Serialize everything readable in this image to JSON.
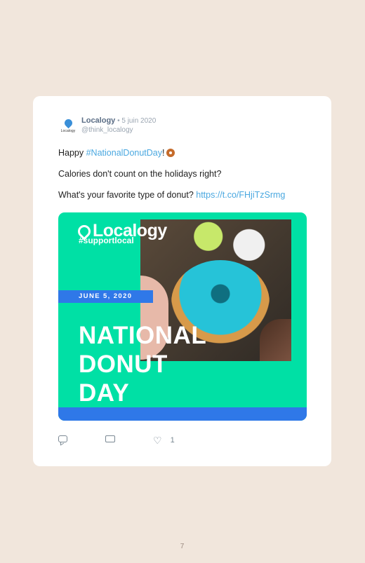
{
  "tweet": {
    "author_name": "Localogy",
    "separator": " • ",
    "date": "5 juin 2020",
    "handle": "@think_localogy",
    "avatar_label": "Localogy",
    "lines": {
      "l1_prefix": "Happy ",
      "l1_hashtag": "#NationalDonutDay",
      "l1_suffix": "!",
      "l2": "Calories don't count on the holidays right?",
      "l3_text": "What's your favorite type of donut? ",
      "l3_link": "https://t.co/FHjiTzSrmg"
    }
  },
  "media": {
    "logo_text": "Localogy",
    "tag": "#supportlocal",
    "date_label": "JUNE 5, 2020",
    "headline_1": "NATIONAL",
    "headline_2": "DONUT",
    "headline_3": "DAY",
    "colors": {
      "background": "#00e0a5",
      "bar": "#2f78e8"
    }
  },
  "actions": {
    "like_count": "1"
  },
  "page": {
    "number": "7"
  },
  "colors": {
    "page_bg": "#f1e6dc",
    "link": "#4aa8e0",
    "author": "#5a6d85"
  }
}
